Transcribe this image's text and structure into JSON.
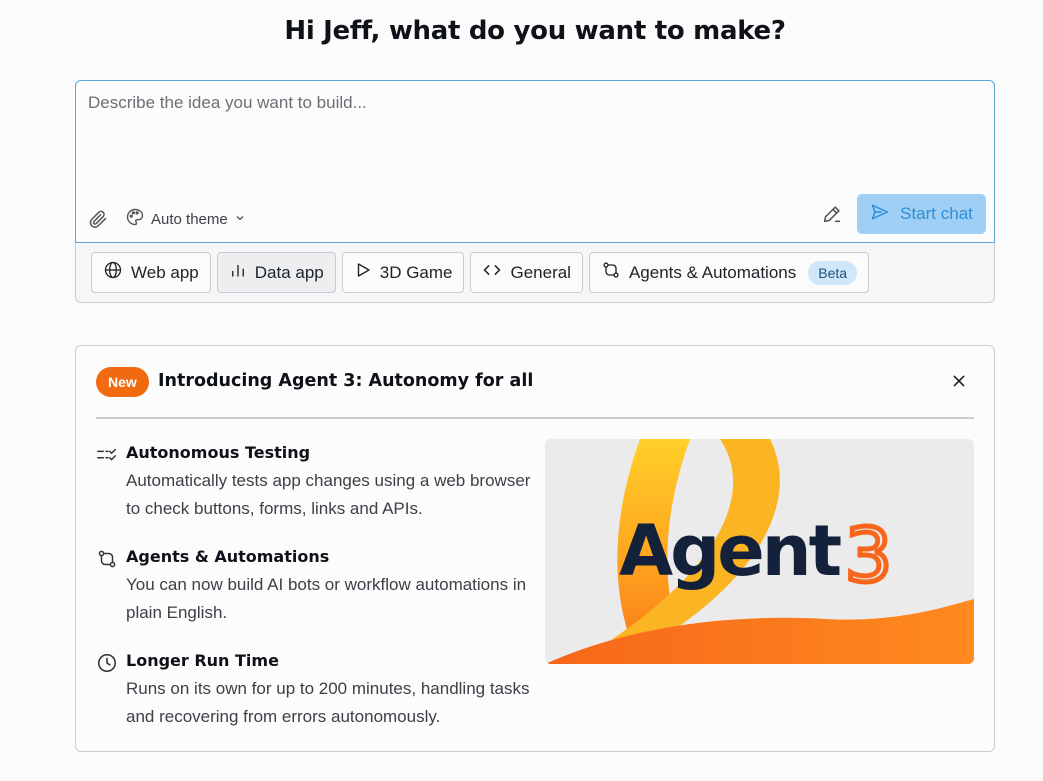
{
  "greeting": "Hi Jeff, what do you want to make?",
  "composer": {
    "placeholder": "Describe the idea you want to build...",
    "theme_label": "Auto theme",
    "start_label": "Start chat"
  },
  "chips": [
    {
      "label": "Web app",
      "icon": "globe-icon"
    },
    {
      "label": "Data app",
      "icon": "bar-chart-icon",
      "active": true
    },
    {
      "label": "3D Game",
      "icon": "play-icon"
    },
    {
      "label": "General",
      "icon": "code-icon"
    },
    {
      "label": "Agents & Automations",
      "icon": "git-branch-icon",
      "badge": "Beta"
    }
  ],
  "announcement": {
    "badge": "New",
    "title": "Introducing Agent 3: Autonomy for all",
    "features": [
      {
        "title": "Autonomous Testing",
        "description": "Automatically tests app changes using a web browser to check buttons, forms, links and APIs.",
        "icon": "checklist-icon"
      },
      {
        "title": "Agents & Automations",
        "description": "You can now build AI bots or workflow automations in plain English.",
        "icon": "git-branch-icon"
      },
      {
        "title": "Longer Run Time",
        "description": "Runs on its own for up to 200 minutes, handling tasks and recovering from errors autonomously.",
        "icon": "clock-icon"
      }
    ],
    "hero": {
      "word": "Agent",
      "number": "3"
    }
  },
  "colors": {
    "accent_orange": "#f26a10",
    "focus_blue": "#5aa7d8",
    "start_button_bg": "#9fcff5",
    "beta_bg": "#cfe6fb"
  }
}
